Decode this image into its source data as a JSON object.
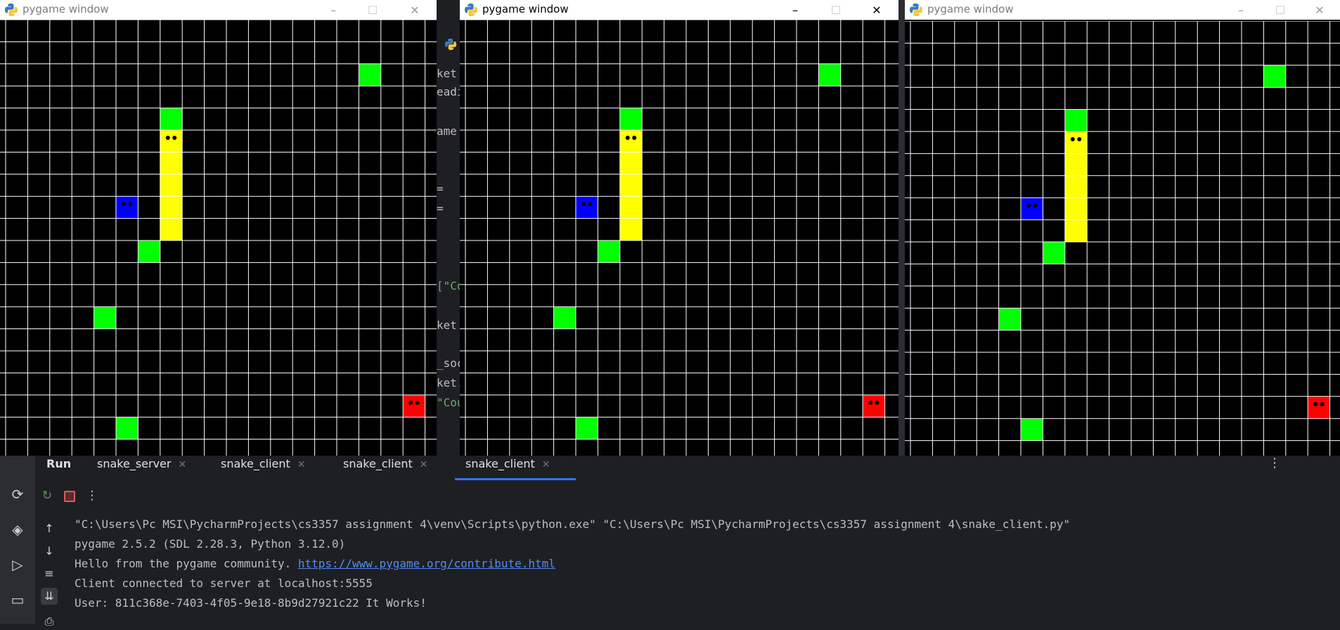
{
  "windows": [
    {
      "title": "pygame window",
      "active": false
    },
    {
      "title": "pygame window",
      "active": true
    },
    {
      "title": "pygame window",
      "active": false
    }
  ],
  "window_controls": {
    "minimize": "–",
    "maximize": "☐",
    "close": "✕"
  },
  "ide_code_fragments": [
    "ket",
    "eadi",
    "ame",
    "=",
    "=",
    "[\"Co",
    "ket",
    "_soc",
    "ket.",
    "\"Cou"
  ],
  "game": {
    "grid_cols": 20,
    "grid_rows": 20,
    "colors": {
      "background": "#000000",
      "grid": "#ffffff",
      "snack": "#00ff00",
      "snake_yellow": "#ffff00",
      "snake_blue": "#0000ff",
      "snake_red": "#ff0000"
    },
    "snacks": [
      [
        16,
        2
      ],
      [
        7,
        4
      ],
      [
        6,
        10
      ],
      [
        4,
        13
      ],
      [
        5,
        18
      ]
    ],
    "snakes": [
      {
        "color": "#ffff00",
        "cells": [
          [
            7,
            5
          ],
          [
            7,
            6
          ],
          [
            7,
            7
          ],
          [
            7,
            8
          ],
          [
            7,
            9
          ]
        ],
        "head": [
          7,
          5
        ]
      },
      {
        "color": "#0000ff",
        "cells": [
          [
            5,
            8
          ]
        ],
        "head": [
          5,
          8
        ]
      },
      {
        "color": "#ff0000",
        "cells": [
          [
            18,
            17
          ]
        ],
        "head": [
          18,
          17
        ]
      }
    ]
  },
  "run_panel": {
    "run_label": "Run",
    "tabs": [
      {
        "label": "snake_server"
      },
      {
        "label": "snake_client"
      },
      {
        "label": "snake_client"
      },
      {
        "label": "snake_client"
      }
    ],
    "console_lines": [
      "\"C:\\Users\\Pc MSI\\PycharmProjects\\cs3357 assignment 4\\venv\\Scripts\\python.exe\" \"C:\\Users\\Pc MSI\\PycharmProjects\\cs3357 assignment 4\\snake_client.py\"",
      "pygame 2.5.2 (SDL 2.28.3, Python 3.12.0)",
      "Hello from the pygame community. ",
      "Client connected to server at localhost:5555",
      "User: 811c368e-7403-4f05-9e18-8b9d27921c22  It Works!"
    ],
    "console_link": "https://www.pygame.org/contribute.html"
  }
}
